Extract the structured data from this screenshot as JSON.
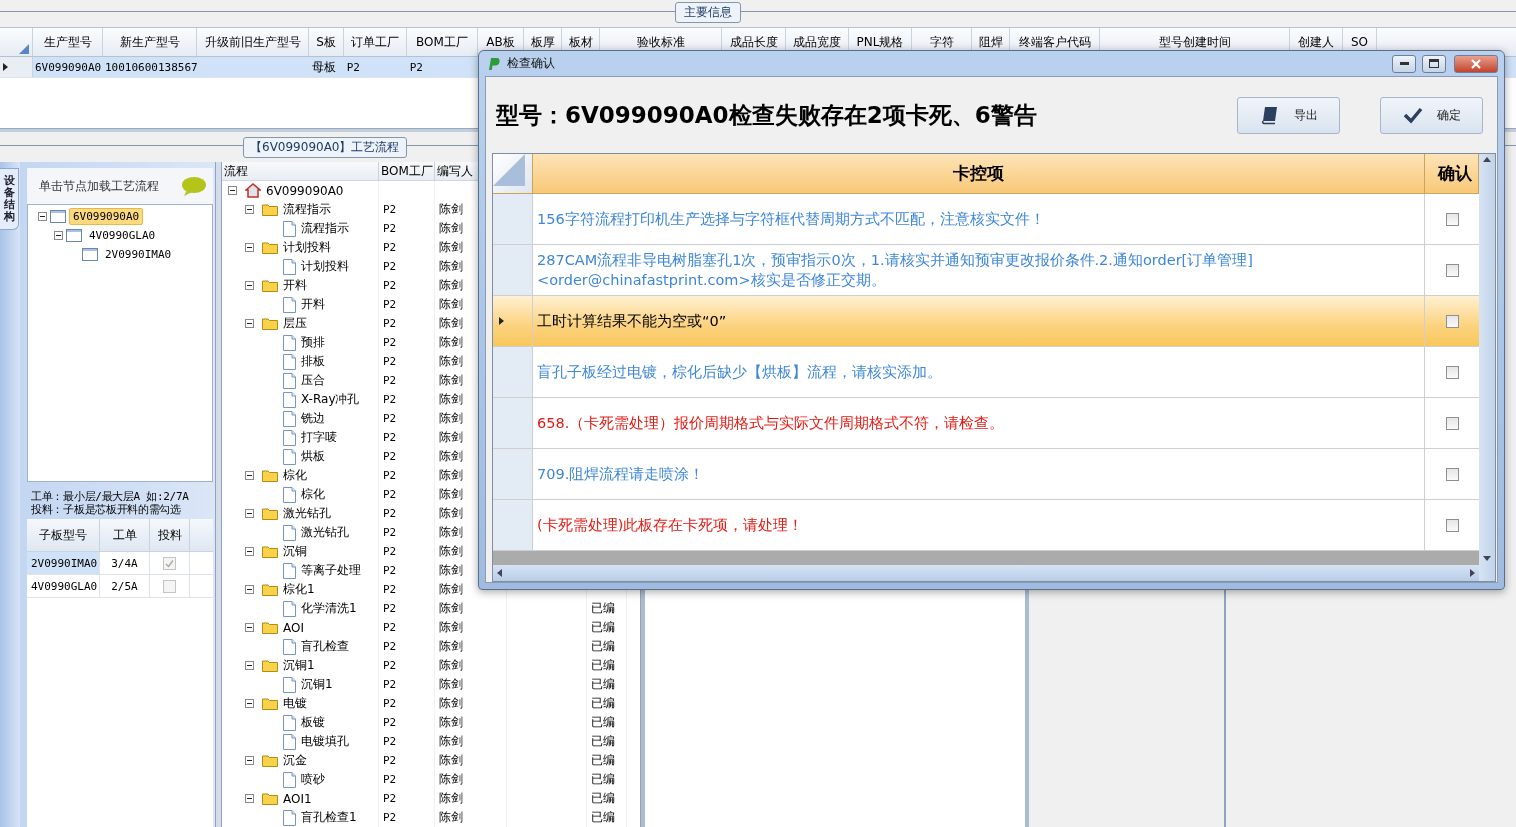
{
  "group_title": "主要信息",
  "main_table": {
    "columns": [
      "生产型号",
      "新生产型号",
      "升级前旧生产型号",
      "S板",
      "订单工厂",
      "BOM工厂",
      "AB板",
      "板厚",
      "板材",
      "验收标准",
      "成品长度",
      "成品宽度",
      "PNL规格",
      "字符",
      "阻焊",
      "终端客户代码",
      "型号创建时间",
      "创建人",
      "SO"
    ],
    "rows": [
      {
        "selected": true,
        "production_model": "6V099090A0",
        "new_model": "10010600138567",
        "s_board": "母板",
        "order_factory": "P2",
        "bom_factory": "P2"
      }
    ]
  },
  "process_title": "【6V099090A0】工艺流程",
  "side_tab": "设备结构",
  "left_panel": {
    "hint": "单击节点加载工艺流程",
    "tree": [
      {
        "label": "6V099090A0",
        "selected": true,
        "expanded": true,
        "children": [
          {
            "label": "4V0990GLA0",
            "selected": false,
            "expanded": true,
            "children": [
              {
                "label": "2V0990IMA0",
                "selected": false
              }
            ]
          }
        ]
      }
    ],
    "notes": [
      "工单：最小层/最大层A 如:2/7A",
      "投料：子板是芯板开料的需勾选"
    ],
    "sub_table": {
      "columns": [
        "子板型号",
        "工单",
        "投料"
      ],
      "rows": [
        {
          "model": "2V0990IMA0",
          "order": "3/4A",
          "checked": true,
          "selected": true
        },
        {
          "model": "4V0990GLA0",
          "order": "2/5A",
          "checked": false,
          "selected": false
        }
      ]
    }
  },
  "flow_tree": {
    "columns": [
      "流程",
      "BOM工厂",
      "编写人"
    ],
    "rows": [
      {
        "label": "6V099090A0",
        "kind": "root",
        "expanded": true,
        "children": [
          {
            "label": "流程指示",
            "kind": "folder",
            "expanded": true,
            "factory": "P2",
            "author": "陈剑",
            "children": [
              {
                "label": "流程指示",
                "kind": "step",
                "factory": "P2",
                "author": "陈剑"
              }
            ]
          },
          {
            "label": "计划投料",
            "kind": "folder",
            "expanded": true,
            "factory": "P2",
            "author": "陈剑",
            "children": [
              {
                "label": "计划投料",
                "kind": "step",
                "factory": "P2",
                "author": "陈剑"
              }
            ]
          },
          {
            "label": "开料",
            "kind": "folder",
            "expanded": true,
            "factory": "P2",
            "author": "陈剑",
            "children": [
              {
                "label": "开料",
                "kind": "step",
                "factory": "P2",
                "author": "陈剑"
              }
            ]
          },
          {
            "label": "层压",
            "kind": "folder",
            "expanded": true,
            "factory": "P2",
            "author": "陈剑",
            "children": [
              {
                "label": "预排",
                "kind": "step",
                "factory": "P2",
                "author": "陈剑"
              },
              {
                "label": "排板",
                "kind": "step",
                "factory": "P2",
                "author": "陈剑"
              },
              {
                "label": "压合",
                "kind": "step",
                "factory": "P2",
                "author": "陈剑"
              },
              {
                "label": "X-Ray冲孔",
                "kind": "step",
                "factory": "P2",
                "author": "陈剑"
              },
              {
                "label": "铣边",
                "kind": "step",
                "factory": "P2",
                "author": "陈剑"
              },
              {
                "label": "打字唛",
                "kind": "step",
                "factory": "P2",
                "author": "陈剑"
              },
              {
                "label": "烘板",
                "kind": "step",
                "factory": "P2",
                "author": "陈剑"
              }
            ]
          },
          {
            "label": "棕化",
            "kind": "folder",
            "expanded": true,
            "factory": "P2",
            "author": "陈剑",
            "children": [
              {
                "label": "棕化",
                "kind": "step",
                "factory": "P2",
                "author": "陈剑"
              }
            ]
          },
          {
            "label": "激光钻孔",
            "kind": "folder",
            "expanded": true,
            "factory": "P2",
            "author": "陈剑",
            "children": [
              {
                "label": "激光钻孔",
                "kind": "step",
                "factory": "P2",
                "author": "陈剑"
              }
            ]
          },
          {
            "label": "沉铜",
            "kind": "folder",
            "expanded": true,
            "factory": "P2",
            "author": "陈剑",
            "children": [
              {
                "label": "等离子处理",
                "kind": "step",
                "factory": "P2",
                "author": "陈剑"
              }
            ]
          },
          {
            "label": "棕化1",
            "kind": "folder",
            "expanded": true,
            "factory": "P2",
            "author": "陈剑",
            "children": [
              {
                "label": "化学清洗1",
                "kind": "step",
                "factory": "P2",
                "author": "陈剑",
                "status": "已编"
              }
            ]
          },
          {
            "label": "AOI",
            "kind": "folder",
            "expanded": true,
            "factory": "P2",
            "author": "陈剑",
            "status": "已编",
            "children": [
              {
                "label": "盲孔检查",
                "kind": "step",
                "factory": "P2",
                "author": "陈剑",
                "status": "已编"
              }
            ]
          },
          {
            "label": "沉铜1",
            "kind": "folder",
            "expanded": true,
            "factory": "P2",
            "author": "陈剑",
            "status": "已编",
            "children": [
              {
                "label": "沉铜1",
                "kind": "step",
                "factory": "P2",
                "author": "陈剑",
                "status": "已编"
              }
            ]
          },
          {
            "label": "电镀",
            "kind": "folder",
            "expanded": true,
            "factory": "P2",
            "author": "陈剑",
            "status": "已编",
            "children": [
              {
                "label": "板镀",
                "kind": "step",
                "factory": "P2",
                "author": "陈剑",
                "status": "已编"
              },
              {
                "label": "电镀填孔",
                "kind": "step",
                "factory": "P2",
                "author": "陈剑",
                "status": "已编"
              }
            ]
          },
          {
            "label": "沉金",
            "kind": "folder",
            "expanded": true,
            "factory": "P2",
            "author": "陈剑",
            "status": "已编",
            "children": [
              {
                "label": "喷砂",
                "kind": "step",
                "factory": "P2",
                "author": "陈剑",
                "status": "已编"
              }
            ]
          },
          {
            "label": "AOI1",
            "kind": "folder",
            "expanded": true,
            "factory": "P2",
            "author": "陈剑",
            "status": "已编",
            "children": [
              {
                "label": "盲孔检查1",
                "kind": "step",
                "factory": "P2",
                "author": "陈剑",
                "status": "已编"
              }
            ]
          }
        ]
      }
    ]
  },
  "dialog": {
    "title": "检查确认",
    "heading": "型号：6V099090A0检查失败存在2项卡死、6警告",
    "buttons": [
      {
        "label": "导出",
        "kind": "export"
      },
      {
        "label": "确定",
        "kind": "confirm"
      }
    ],
    "columns": [
      "卡控项",
      "确认"
    ],
    "items": [
      {
        "text": "156字符流程打印机生产选择与字符框代替周期方式不匹配，注意核实文件！",
        "kind": "warning",
        "selected": false,
        "checked": false
      },
      {
        "text": "287CAM流程非导电树脂塞孔1次，预审指示0次，1.请核实并通知预审更改报价条件.2.通知order[订单管理]<order@chinafastprint.com>核实是否修正交期。",
        "kind": "warning",
        "selected": false,
        "checked": false
      },
      {
        "text": "工时计算结果不能为空或“0”",
        "kind": "info",
        "selected": true,
        "checked": false
      },
      {
        "text": "盲孔子板经过电镀，棕化后缺少【烘板】流程，请核实添加。",
        "kind": "warning",
        "selected": false,
        "checked": false
      },
      {
        "text": "658.（卡死需处理）报价周期格式与实际文件周期格式不符，请检查。",
        "kind": "fatal",
        "selected": false,
        "checked": false
      },
      {
        "text": "709.阻焊流程请走喷涂！",
        "kind": "warning",
        "selected": false,
        "checked": false
      },
      {
        "text": "(卡死需处理)此板存在卡死项，请处理！",
        "kind": "fatal",
        "selected": false,
        "checked": false
      }
    ]
  }
}
